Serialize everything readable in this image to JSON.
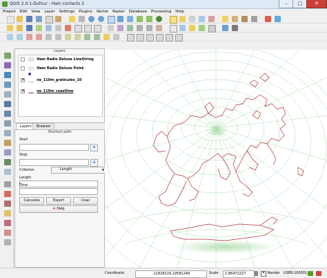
{
  "window": {
    "title": "QGIS 2.0.1-Dufour - Ham contacts 2"
  },
  "window_controls": {
    "minimize": "–",
    "maximize": "□",
    "close": "✕"
  },
  "menu": [
    "Project",
    "Edit",
    "View",
    "Layer",
    "Settings",
    "Plugins",
    "Vector",
    "Raster",
    "Database",
    "Processing",
    "Help"
  ],
  "layers_panel": {
    "title": "Layers",
    "layers": [
      {
        "name": "Ham Radio Deluxe LineString",
        "checked": false,
        "symbol": "line"
      },
      {
        "name": "Ham Radio Deluxe Point",
        "checked": false,
        "symbol": "point"
      },
      {
        "name": "ne_110m_graticules_10",
        "checked": true,
        "symbol": "line-green"
      },
      {
        "name": "ne_110m_coastline",
        "checked": true,
        "symbol": "line-red"
      }
    ],
    "tabs": [
      "Layers",
      "Browser"
    ]
  },
  "shortest_path": {
    "title": "Shortest path",
    "start_label": "Start",
    "stop_label": "Stop",
    "criterion_label": "Criterion",
    "criterion_value": "Length",
    "length_label": "Length",
    "time_label": "Time",
    "plus": "+",
    "buttons": {
      "calculate": "Calculate",
      "export": "Export",
      "clear": "Clear",
      "help": "Help"
    }
  },
  "status": {
    "coordinate_label": "Coordinate:",
    "coordinate_value": "-11828224,19581248",
    "scale_label": "Scale",
    "scale_value": "1:86472227",
    "render_label": "Render",
    "crs": "USER:100001"
  },
  "colors": {
    "graticule": "#9ed89e",
    "coastline": "#b0303a",
    "accent": "#1b64c0"
  }
}
